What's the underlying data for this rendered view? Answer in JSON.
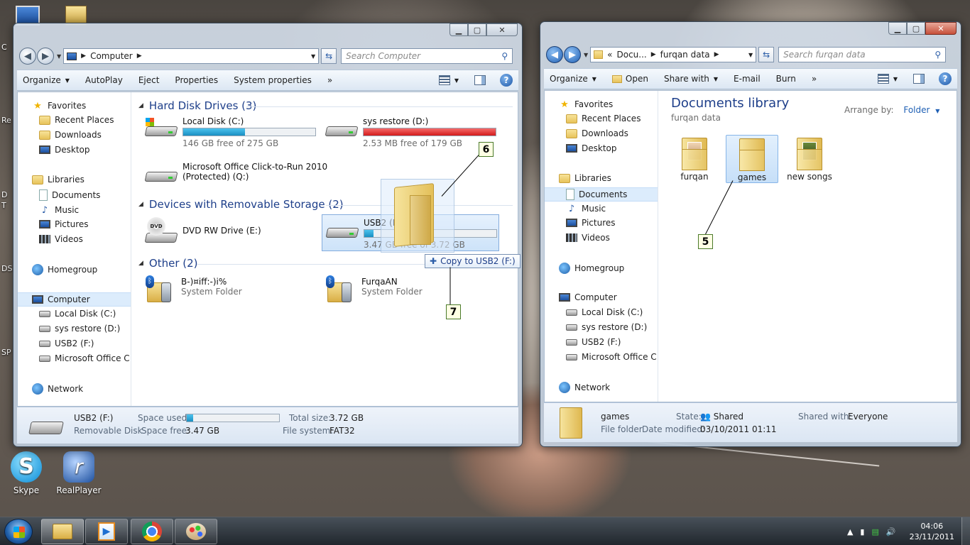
{
  "desktop": {
    "icons": [
      {
        "label": "Skype"
      },
      {
        "label": "RealPlayer"
      }
    ],
    "edge_text": [
      "C",
      "Re",
      "D",
      "T",
      "DS",
      "SP"
    ]
  },
  "computer_window": {
    "address": [
      "Computer"
    ],
    "search_placeholder": "Search Computer",
    "toolbar": [
      "Organize",
      "AutoPlay",
      "Eject",
      "Properties",
      "System properties",
      "»"
    ],
    "nav": {
      "favorites": "Favorites",
      "fav_items": [
        "Recent Places",
        "Downloads",
        "Desktop"
      ],
      "libraries": "Libraries",
      "lib_items": [
        "Documents",
        "Music",
        "Pictures",
        "Videos"
      ],
      "homegroup": "Homegroup",
      "computer": "Computer",
      "comp_items": [
        "Local Disk (C:)",
        "sys restore (D:)",
        "USB2 (F:)",
        "Microsoft Office Clic"
      ],
      "network": "Network"
    },
    "groups": {
      "hard_disks": "Hard Disk Drives (3)",
      "removable": "Devices with Removable Storage (2)",
      "other": "Other (2)"
    },
    "drives": {
      "c": {
        "name": "Local Disk (C:)",
        "free": "146 GB free of 275 GB",
        "used_fraction": 0.47
      },
      "d": {
        "name": "sys restore (D:)",
        "free": "2.53 MB free of 179 GB",
        "used_fraction": 0.999
      },
      "q": {
        "name": "Microsoft Office Click-to-Run 2010",
        "name2": "(Protected) (Q:)"
      },
      "e": {
        "name": "DVD RW Drive (E:)"
      },
      "f": {
        "name": "USB2 (F:)",
        "free": "3.47 GB free of 3.72 GB",
        "used_fraction": 0.07
      }
    },
    "other_items": [
      {
        "name": "B-)¤iff:-)i%",
        "type": "System Folder"
      },
      {
        "name": "FurqaAN",
        "type": "System Folder"
      }
    ],
    "details": {
      "name": "USB2 (F:)",
      "type": "Removable Disk",
      "space_used_label": "Space used:",
      "space_used_fraction": 0.07,
      "space_free_label": "Space free:",
      "space_free": "3.47 GB",
      "total_size_label": "Total size:",
      "total_size": "3.72 GB",
      "fs_label": "File system:",
      "fs": "FAT32"
    },
    "drag_tooltip": "Copy to USB2 (F:)"
  },
  "library_window": {
    "address": [
      "«",
      "Docu...",
      "furqan data"
    ],
    "search_placeholder": "Search furqan data",
    "toolbar": [
      "Organize",
      "Open",
      "Share with",
      "E-mail",
      "Burn",
      "»"
    ],
    "nav": {
      "favorites": "Favorites",
      "fav_items": [
        "Recent Places",
        "Downloads",
        "Desktop"
      ],
      "libraries": "Libraries",
      "lib_items": [
        "Documents",
        "Music",
        "Pictures",
        "Videos"
      ],
      "homegroup": "Homegroup",
      "computer": "Computer",
      "comp_items": [
        "Local Disk (C:)",
        "sys restore (D:)",
        "USB2 (F:)",
        "Microsoft Office Clic"
      ],
      "network": "Network"
    },
    "title": "Documents library",
    "subtitle": "furqan data",
    "arrange_label": "Arrange by:",
    "arrange_value": "Folder",
    "folders": [
      "furqan",
      "games",
      "new songs"
    ],
    "selected_folder": "games",
    "details": {
      "name": "games",
      "type": "File folder",
      "state_label": "State:",
      "state": "Shared",
      "shared_label": "Shared with:",
      "shared": "Everyone",
      "modified_label": "Date modified:",
      "modified": "03/10/2011 01:11"
    }
  },
  "callouts": [
    "5",
    "6",
    "7"
  ],
  "taskbar": {
    "time": "04:06",
    "date": "23/11/2011"
  },
  "colors": {
    "link_blue": "#1e3f8a",
    "bar_blue": "#1a8fc2",
    "bar_red": "#d21b1b"
  }
}
